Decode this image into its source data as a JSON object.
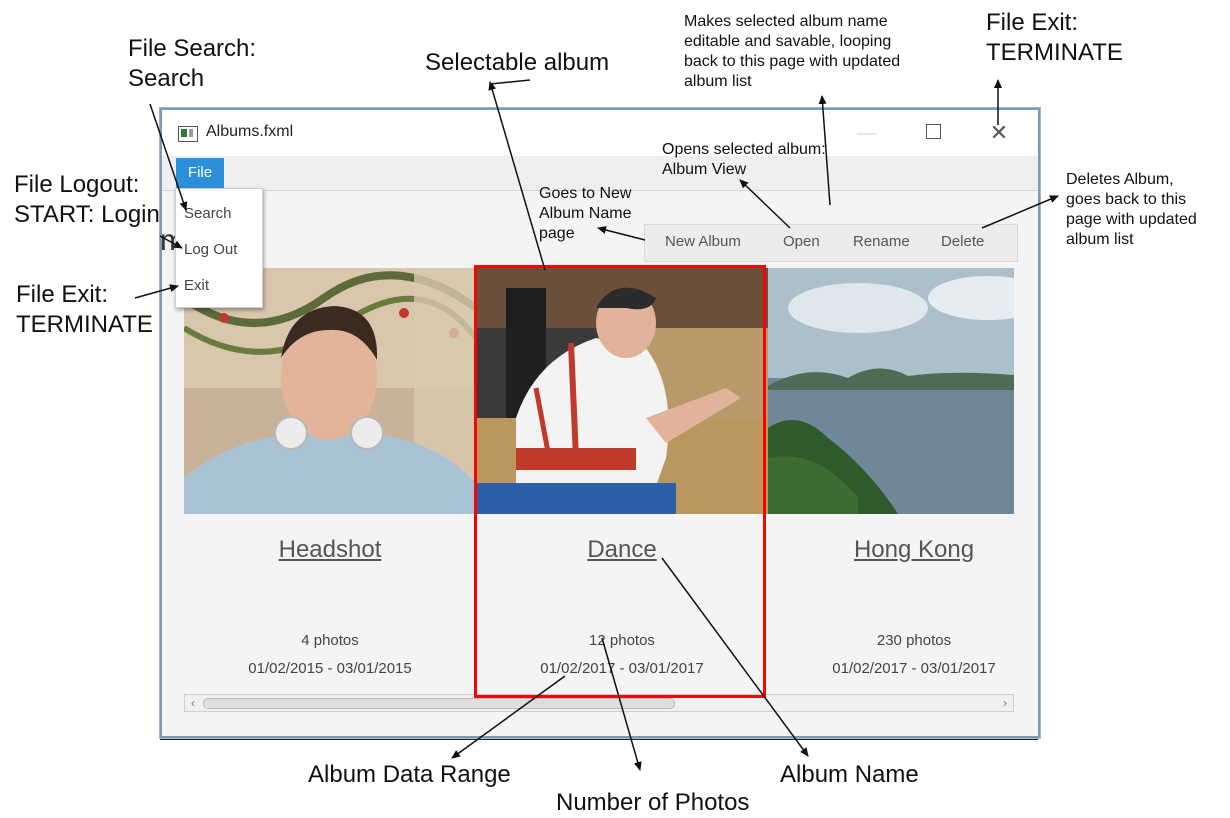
{
  "window": {
    "title": "Albums.fxml",
    "minimize": "—",
    "close": "✕"
  },
  "menubar": {
    "file_label": "File"
  },
  "file_menu": {
    "items": [
      "Search",
      "Log Out",
      "Exit"
    ]
  },
  "page": {
    "heading": "ms:"
  },
  "toolbar": {
    "new_album": "New Album",
    "open": "Open",
    "rename": "Rename",
    "delete": "Delete"
  },
  "albums": [
    {
      "name": "Headshot",
      "photos": "4 photos",
      "range": "01/02/2015 - 03/01/2015"
    },
    {
      "name": "Dance",
      "photos": "12 photos",
      "range": "01/02/2017 - 03/01/2017",
      "selected": true
    },
    {
      "name": "Hong Kong",
      "photos": "230 photos",
      "range": "01/02/2017 - 03/01/2017"
    }
  ],
  "annotations": {
    "file_search": [
      "File Search:",
      "Search"
    ],
    "selectable_album": "Selectable album",
    "rename_note": [
      "Makes selected album name",
      "editable and savable, looping",
      "back to this page with updated",
      "album list"
    ],
    "file_exit_top": [
      "File Exit:",
      "TERMINATE"
    ],
    "file_logout": [
      "File Logout:",
      "START: Login"
    ],
    "open_note": [
      "Opens selected album:",
      "Album View"
    ],
    "new_album_note": [
      "Goes to New",
      "Album Name",
      "page"
    ],
    "delete_note": [
      "Deletes Album,",
      "goes back to this",
      "page with updated",
      "album list"
    ],
    "file_exit_left": [
      "File Exit:",
      "TERMINATE"
    ],
    "album_data_range": "Album Data Range",
    "album_name": "Album Name",
    "number_of_photos": "Number of Photos"
  },
  "colors": {
    "accent": "#2b90d9",
    "selection": "#ff0000"
  }
}
